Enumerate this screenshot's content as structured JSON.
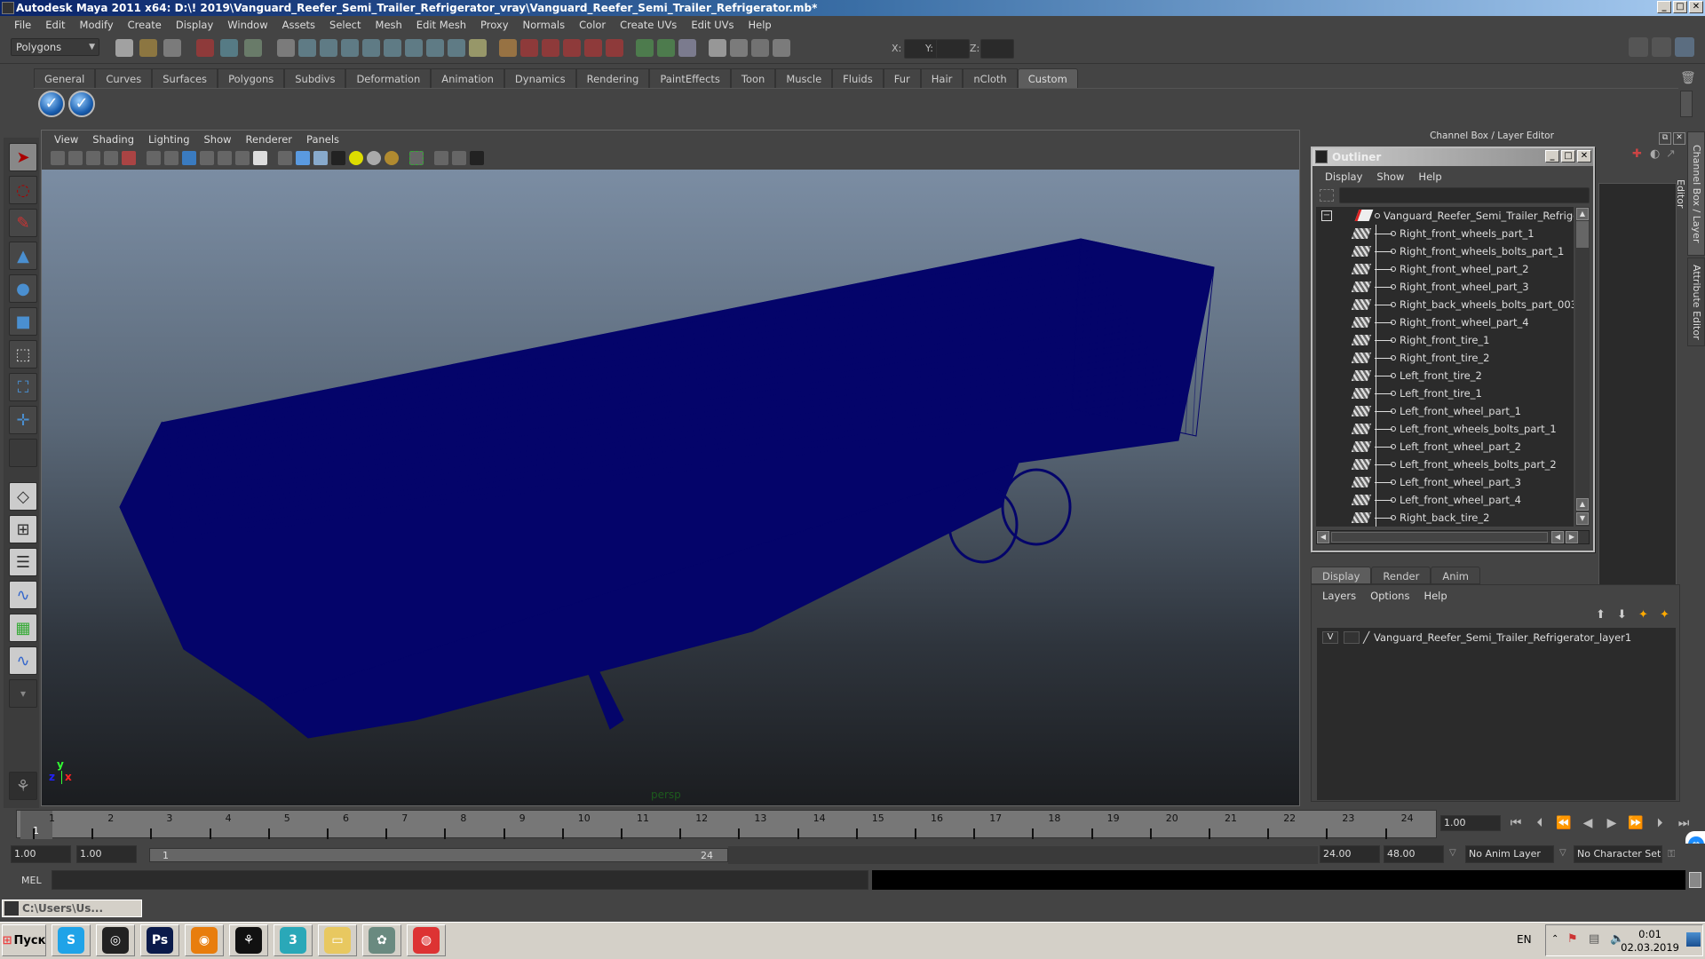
{
  "window": {
    "title": "Autodesk Maya 2011 x64: D:\\! 2019\\Vanguard_Reefer_Semi_Trailer_Refrigerator_vray\\Vanguard_Reefer_Semi_Trailer_Refrigerator.mb*",
    "controls": {
      "minimize": "_",
      "maximize": "□",
      "close": "✕"
    }
  },
  "menubar": [
    "File",
    "Edit",
    "Modify",
    "Create",
    "Display",
    "Window",
    "Assets",
    "Select",
    "Mesh",
    "Edit Mesh",
    "Proxy",
    "Normals",
    "Color",
    "Create UVs",
    "Edit UVs",
    "Help"
  ],
  "statusline": {
    "mode_selector": "Polygons",
    "coord_labels": {
      "x": "X:",
      "y": "Y:",
      "z": "Z:"
    },
    "coord_values": {
      "x": "",
      "y": "",
      "z": ""
    }
  },
  "shelf": {
    "tabs": [
      "General",
      "Curves",
      "Surfaces",
      "Polygons",
      "Subdivs",
      "Deformation",
      "Animation",
      "Dynamics",
      "Rendering",
      "PaintEffects",
      "Toon",
      "Muscle",
      "Fluids",
      "Fur",
      "Hair",
      "nCloth",
      "Custom"
    ],
    "active_tab": "Custom",
    "buttons": [
      "check-icon",
      "check-icon"
    ]
  },
  "toolbox": {
    "tools": [
      "select-tool",
      "lasso-tool",
      "paint-select-tool",
      "move-tool",
      "rotate-tool",
      "scale-tool",
      "universal-manipulator",
      "soft-mod-tool",
      "show-manipulator"
    ],
    "layouts": [
      "single-perspective",
      "four-view",
      "outliner-persp",
      "persp-graph",
      "hypershade-persp",
      "persp-graph-hypergraph"
    ],
    "expand": "▾"
  },
  "viewport": {
    "menu": [
      "View",
      "Shading",
      "Lighting",
      "Show",
      "Renderer",
      "Panels"
    ],
    "camera_label": "persp",
    "axis": {
      "x": "x",
      "y": "y",
      "z": "z"
    },
    "wire_color": "#04046a"
  },
  "channel_box": {
    "title": "Channel Box / Layer Editor",
    "side_tabs": [
      "Channel Box / Layer Editor",
      "Attribute Editor"
    ]
  },
  "outliner": {
    "title": "Outliner",
    "menu": [
      "Display",
      "Show",
      "Help"
    ],
    "search_value": "",
    "root": "Vanguard_Reefer_Semi_Trailer_Refrigerator",
    "items": [
      "Right_front_wheels_part_1",
      "Right_front_wheels_bolts_part_1",
      "Right_front_wheel_part_2",
      "Right_front_wheel_part_3",
      "Right_back_wheels_bolts_part_003",
      "Right_front_wheel_part_4",
      "Right_front_tire_1",
      "Right_front_tire_2",
      "Left_front_tire_2",
      "Left_front_tire_1",
      "Left_front_wheel_part_1",
      "Left_front_wheels_bolts_part_1",
      "Left_front_wheel_part_2",
      "Left_front_wheels_bolts_part_2",
      "Left_front_wheel_part_3",
      "Left_front_wheel_part_4",
      "Right_back_tire_2"
    ]
  },
  "layer_editor": {
    "tabs": [
      "Display",
      "Render",
      "Anim"
    ],
    "active_tab": "Display",
    "menu": [
      "Layers",
      "Options",
      "Help"
    ],
    "layers": [
      {
        "visible": "V",
        "playback": "",
        "name": "Vanguard_Reefer_Semi_Trailer_Refrigerator_layer1"
      }
    ]
  },
  "timeline": {
    "ticks": [
      "1",
      "2",
      "3",
      "4",
      "5",
      "6",
      "7",
      "8",
      "9",
      "10",
      "11",
      "12",
      "13",
      "14",
      "15",
      "16",
      "17",
      "18",
      "19",
      "20",
      "21",
      "22",
      "23",
      "24"
    ],
    "current_marker": "1",
    "current_frame": "1.00",
    "playback_buttons": [
      "⏮",
      "⏭|",
      "|◀",
      "◀",
      "▶",
      "▶|",
      "▶|",
      "⏭"
    ]
  },
  "range": {
    "start_time": "1.00",
    "playback_start": "1.00",
    "slider_start": "1",
    "slider_end": "24",
    "playback_end": "24.00",
    "end_time": "48.00",
    "anim_layer": "No Anim Layer",
    "character_set": "No Character Set"
  },
  "command_line": {
    "label": "MEL",
    "value": "",
    "result": ""
  },
  "minimized_window": {
    "title": "C:\\Users\\Us..."
  },
  "taskbar": {
    "start_label": "Пуск",
    "apps": [
      "skype",
      "3ds-max-old",
      "photoshop",
      "blender",
      "maya",
      "3ds-max",
      "file-explorer",
      "mudbox",
      "chrome"
    ],
    "language": "EN",
    "time": "0:01",
    "date": "02.03.2019"
  }
}
